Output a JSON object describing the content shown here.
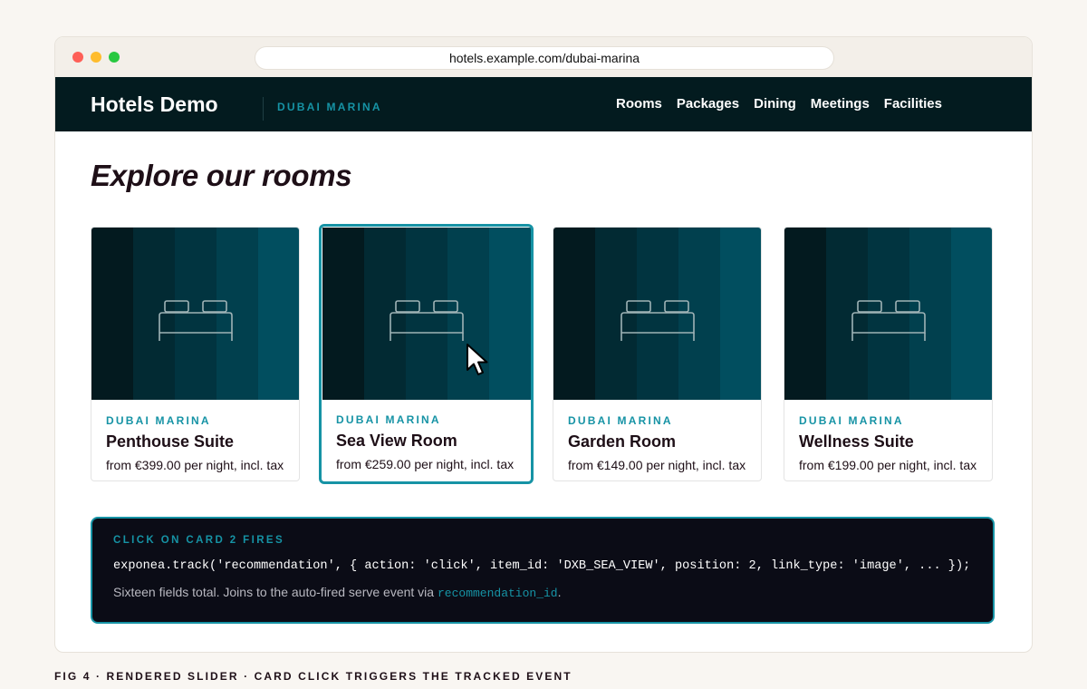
{
  "browser": {
    "url": "hotels.example.com/dubai-marina"
  },
  "navbar": {
    "brand": "Hotels Demo",
    "location": "DUBAI MARINA",
    "links": [
      "Rooms",
      "Packages",
      "Dining",
      "Meetings",
      "Facilities"
    ]
  },
  "main": {
    "heading": "Explore our rooms"
  },
  "cards": [
    {
      "location": "DUBAI MARINA",
      "title": "Penthouse Suite",
      "price": "from €399.00 per night, incl. tax"
    },
    {
      "location": "DUBAI MARINA",
      "title": "Sea View Room",
      "price": "from €259.00 per night, incl. tax"
    },
    {
      "location": "DUBAI MARINA",
      "title": "Garden Room",
      "price": "from €149.00 per night, incl. tax"
    },
    {
      "location": "DUBAI MARINA",
      "title": "Wellness Suite",
      "price": "from €199.00 per night, incl. tax"
    }
  ],
  "event_panel": {
    "label": "CLICK ON CARD 2 FIRES",
    "code": "exponea.track('recommendation', { action: 'click', item_id: 'DXB_SEA_VIEW', position: 2, link_type: 'image', ... });",
    "note_prefix": "Sixteen fields total. Joins to the auto-fired serve event via ",
    "note_field": "recommendation_id",
    "note_suffix": "."
  },
  "caption": "FIG 4 · RENDERED SLIDER · CARD CLICK TRIGGERS THE TRACKED EVENT",
  "colors": {
    "accent": "#1693a5",
    "nav_bg": "#031b1f",
    "code_bg": "#0b0c16",
    "stripes": [
      "#031a1f",
      "#022a33",
      "#013440",
      "#01404e",
      "#014e5f"
    ]
  },
  "icons": {
    "card_image": "bed-icon",
    "pointer": "mouse-cursor-icon"
  }
}
